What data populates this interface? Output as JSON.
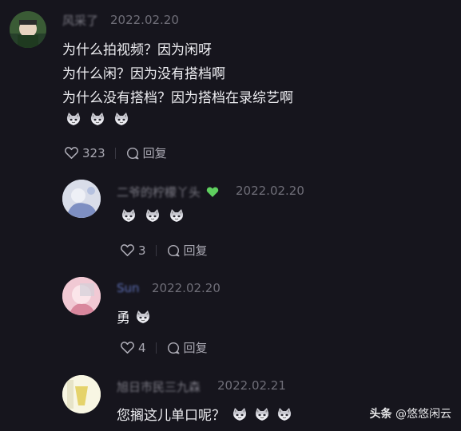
{
  "comments": [
    {
      "username": "风采了",
      "date": "2022.02.20",
      "lines": [
        "为什么拍视频？因为闲呀",
        "为什么闲？因为没有搭档啊",
        "为什么没有搭档？因为搭档在录综艺啊"
      ],
      "likes": "323",
      "reply_label": "回复"
    },
    {
      "username": "二爷的柠檬丫头",
      "date": "2022.02.20",
      "likes": "3",
      "reply_label": "回复"
    },
    {
      "username": "Sun",
      "date": "2022.02.20",
      "text": "勇",
      "likes": "4",
      "reply_label": "回复"
    },
    {
      "username": "旭日市民三九森",
      "date": "2022.02.21",
      "text": "您搁这儿单口呢？"
    }
  ],
  "watermark": {
    "brand": "头条",
    "handle": "@悠悠闲云"
  },
  "colors": {
    "background": "#16151d",
    "text": "#eeeef2",
    "muted": "#8d8c96",
    "heart_green": "#5fcf5f"
  },
  "icons": [
    "heart-outline-icon",
    "comment-bubble-icon",
    "cat-emoji-icon",
    "green-heart-emoji"
  ]
}
